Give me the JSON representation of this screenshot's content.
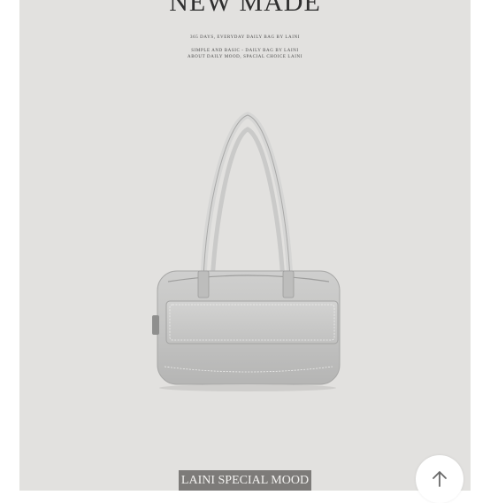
{
  "header": {
    "headline": "NEW MADE",
    "tagline": "365 DAYS, EVERYDAY DAILY BAG BY LAINI",
    "desc_line1": "SIMPLE AND BASIC - DAILY BAG BY LAINI",
    "desc_line2": "ABOUT DAILY MOOD, SPACIAL CHOICE LAINI"
  },
  "product": {
    "image_alt": "handbag-photo",
    "colors": {
      "background": "#e2e1df",
      "bag": "#c9c9c8"
    }
  },
  "badge": {
    "label": "LAINI SPECIAL MOOD"
  },
  "controls": {
    "scroll_top_icon": "arrow-up-icon"
  }
}
